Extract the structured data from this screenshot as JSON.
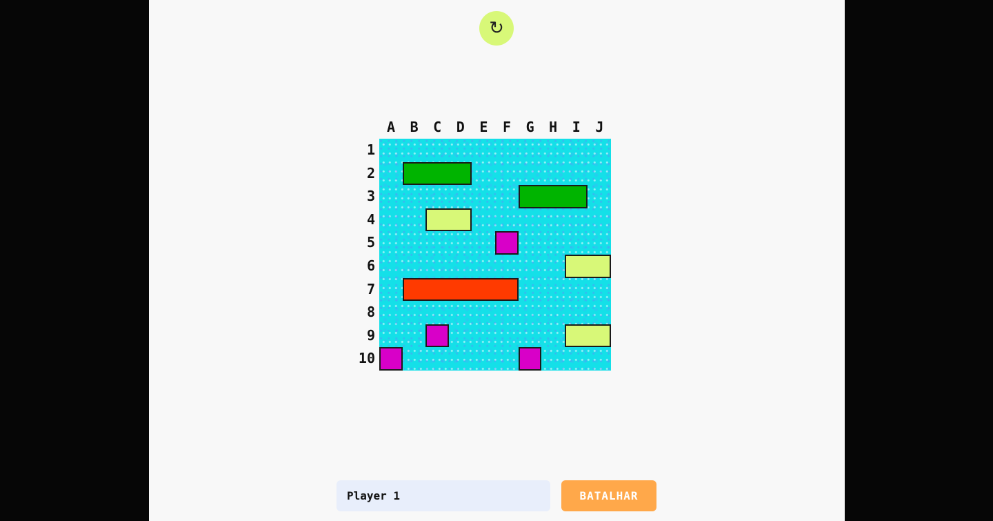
{
  "toolbar": {
    "refresh_icon": "↻",
    "refresh_icon_name": "refresh-icon"
  },
  "board": {
    "columns": [
      "A",
      "B",
      "C",
      "D",
      "E",
      "F",
      "G",
      "H",
      "I",
      "J"
    ],
    "rows": [
      "1",
      "2",
      "3",
      "4",
      "5",
      "6",
      "7",
      "8",
      "9",
      "10"
    ],
    "water_color": "#14e0e8",
    "ships": [
      {
        "name": "ship-green-2b",
        "start": "B2",
        "length": 3,
        "orientation": "horizontal",
        "color": "#00b400"
      },
      {
        "name": "ship-green-3g",
        "start": "G3",
        "length": 3,
        "orientation": "horizontal",
        "color": "#00b400"
      },
      {
        "name": "ship-yellow-4c",
        "start": "C4",
        "length": 2,
        "orientation": "horizontal",
        "color": "#d8f878"
      },
      {
        "name": "ship-magenta-5f",
        "start": "F5",
        "length": 1,
        "orientation": "horizontal",
        "color": "#d800c8"
      },
      {
        "name": "ship-yellow-6i",
        "start": "I6",
        "length": 2,
        "orientation": "horizontal",
        "color": "#d8f878"
      },
      {
        "name": "ship-orange-7b",
        "start": "B7",
        "length": 5,
        "orientation": "horizontal",
        "color": "#ff3a00"
      },
      {
        "name": "ship-magenta-9c",
        "start": "C9",
        "length": 1,
        "orientation": "horizontal",
        "color": "#d800c8"
      },
      {
        "name": "ship-yellow-9i",
        "start": "I9",
        "length": 2,
        "orientation": "horizontal",
        "color": "#d8f878"
      },
      {
        "name": "ship-magenta-10a",
        "start": "A10",
        "length": 1,
        "orientation": "horizontal",
        "color": "#d800c8"
      },
      {
        "name": "ship-magenta-10g",
        "start": "G10",
        "length": 1,
        "orientation": "horizontal",
        "color": "#d800c8"
      }
    ]
  },
  "footer": {
    "player_name_value": "Player 1",
    "battle_label": "BATALHAR",
    "battle_color": "#ffa84a"
  }
}
